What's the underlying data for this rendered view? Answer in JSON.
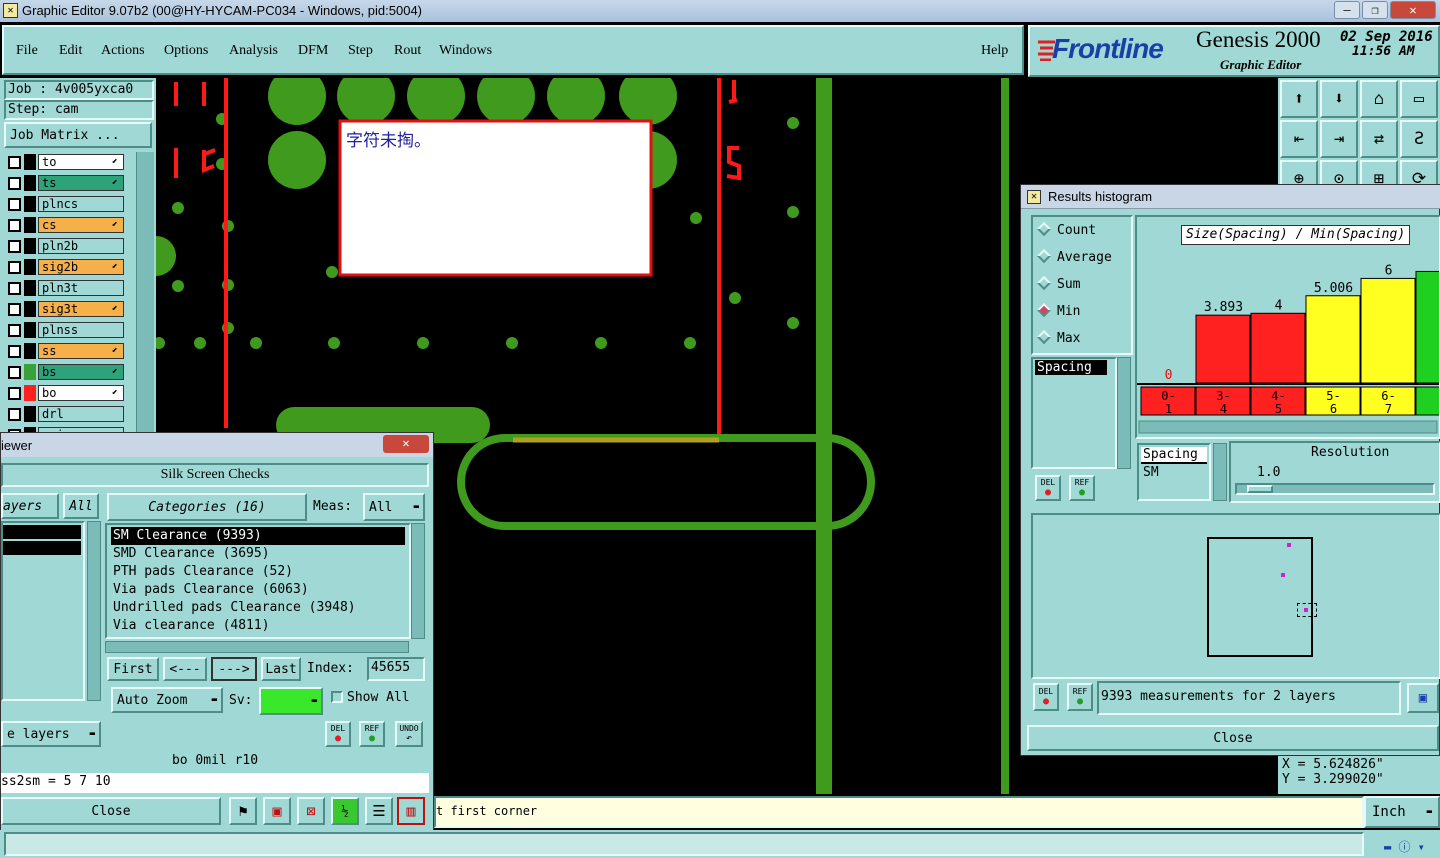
{
  "window": {
    "title": "Graphic Editor 9.07b2 (00@HY-HYCAM-PC034 - Windows, pid:5004)"
  },
  "menu": {
    "file": "File",
    "edit": "Edit",
    "actions": "Actions",
    "options": "Options",
    "analysis": "Analysis",
    "dfm": "DFM",
    "step": "Step",
    "rout": "Rout",
    "windows": "Windows",
    "help": "Help"
  },
  "brand": {
    "logo": "Frontline",
    "product": "Genesis 2000",
    "subtitle": "Graphic Editor",
    "date": "02 Sep 2016",
    "time": "11:56 AM"
  },
  "job": {
    "job_label": "Job : 4v005yxca0",
    "step_label": "Step: cam",
    "matrix_button": "Job Matrix ..."
  },
  "layers": [
    {
      "name": "to",
      "fill": "#ffffff",
      "swatch": "#000000",
      "arrow": "⬋"
    },
    {
      "name": "ts",
      "fill": "#2ea37a",
      "swatch": "#000000",
      "arrow": "⬋"
    },
    {
      "name": "plncs",
      "fill": "#9fd8d4",
      "swatch": "#000000",
      "arrow": ""
    },
    {
      "name": "cs",
      "fill": "#f6b04a",
      "swatch": "#000000",
      "arrow": "⬋"
    },
    {
      "name": "pln2b",
      "fill": "#9fd8d4",
      "swatch": "#000000",
      "arrow": ""
    },
    {
      "name": "sig2b",
      "fill": "#f6b04a",
      "swatch": "#000000",
      "arrow": "⬋"
    },
    {
      "name": "pln3t",
      "fill": "#9fd8d4",
      "swatch": "#000000",
      "arrow": ""
    },
    {
      "name": "sig3t",
      "fill": "#f6b04a",
      "swatch": "#000000",
      "arrow": "⬋"
    },
    {
      "name": "plnss",
      "fill": "#9fd8d4",
      "swatch": "#000000",
      "arrow": ""
    },
    {
      "name": "ss",
      "fill": "#f6b04a",
      "swatch": "#000000",
      "arrow": "⬋"
    },
    {
      "name": "bs",
      "fill": "#2ea37a",
      "swatch": "#3aa03a",
      "arrow": "⬋"
    },
    {
      "name": "bo",
      "fill": "#ffffff",
      "swatch": "#ff2020",
      "arrow": "⬋"
    },
    {
      "name": "drl",
      "fill": "#9fd8d4",
      "swatch": "#000000",
      "arrow": ""
    },
    {
      "name": "cvia",
      "fill": "#9fd8d4",
      "swatch": "#000000",
      "arrow": ""
    }
  ],
  "canvas": {
    "note_text": "字符未掏。",
    "labels": [
      "I I",
      "I 5",
      "S",
      "I"
    ]
  },
  "toolbar_icons": [
    "up-arrow-icon",
    "down-arrow-icon",
    "home-icon",
    "window-icon",
    "left-arrow-icon",
    "right-arrow-icon",
    "swap-icon",
    "s-route-icon"
  ],
  "results": {
    "title": "Results histogram",
    "options": [
      "Count",
      "Average",
      "Sum",
      "Min",
      "Max"
    ],
    "selected_option": "Min",
    "metric_title": "Size(Spacing) / Min(Spacing)",
    "list_item": "Spacing",
    "del": "DEL",
    "ref": "REF",
    "chart_data": {
      "type": "bar",
      "categories": [
        "0-1",
        "3-4",
        "4-5",
        "5-6",
        "6-7",
        "7"
      ],
      "values": [
        0,
        3.893,
        4,
        5.006,
        6,
        6.4
      ],
      "data_labels": [
        "0",
        "3.893",
        "4",
        "5.006",
        "6",
        ""
      ],
      "colors": [
        "#ff2020",
        "#ff2020",
        "#ff2020",
        "#ffff20",
        "#ffff20",
        "#20d020"
      ],
      "category_label_colors": [
        "#ff2020",
        "#ff2020",
        "#ff2020",
        "#ffff20",
        "#ffff20",
        "#20d020"
      ],
      "ylim": [
        0,
        7
      ]
    },
    "sel_list": [
      "Spacing",
      "SM"
    ],
    "resolution_label": "Resolution",
    "resolution_value": "1.0",
    "summary": "9393 measurements for 2 layers",
    "close": "Close"
  },
  "coords": {
    "x": "X = 5.624826\"",
    "y": "Y = 3.299020\""
  },
  "units": "Inch",
  "viewer": {
    "title": "iewer",
    "heading": "Silk Screen Checks",
    "layers_label": "ayers",
    "all_label": "All",
    "categories_label": "Categories (16)",
    "meas_label": "Meas:",
    "meas_value": "All",
    "categories": [
      "SM Clearance (9393)",
      "SMD Clearance (3695)",
      "PTH pads Clearance (52)",
      "Via pads Clearance (6063)",
      "Undrilled pads Clearance (3948)",
      "Via clearance (4811)"
    ],
    "first": "First",
    "prev": "<---",
    "next": "--->",
    "last": "Last",
    "index_label": "Index:",
    "index_value": "45655",
    "auto_zoom": "Auto Zoom",
    "sv_label": "Sv:",
    "show_all": "Show All",
    "layers_button": "e layers",
    "del": "DEL",
    "ref": "REF",
    "undo": "UNDO",
    "info_line": "bo 0mil r10",
    "param_line": "ss2sm = 5 7 10",
    "close": "Close"
  },
  "status": {
    "prompt": "t first corner"
  }
}
